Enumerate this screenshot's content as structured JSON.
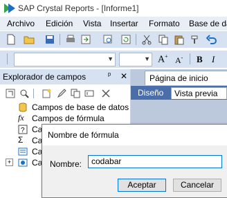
{
  "window": {
    "title": "SAP Crystal Reports - [Informe1]"
  },
  "menubar": {
    "items": [
      "Archivo",
      "Edición",
      "Vista",
      "Insertar",
      "Formato",
      "Base de da"
    ]
  },
  "explorer": {
    "title": "Explorador de campos",
    "pin": "ᵖ",
    "close": "✕",
    "tree": [
      {
        "label": "Campos de base de datos",
        "icon": "database-icon"
      },
      {
        "label": "Campos de fórmula",
        "icon": "formula-icon"
      },
      {
        "label": "Ca",
        "icon": "parameter-icon"
      },
      {
        "label": "Ca",
        "icon": "running-total-icon"
      },
      {
        "label": "Ca",
        "icon": "sql-icon"
      },
      {
        "label": "Ca",
        "icon": "special-fields-icon"
      }
    ]
  },
  "tabs": {
    "start_page": "Página de inicio",
    "design": "Diseño",
    "preview": "Vista previa"
  },
  "dialog": {
    "title": "Nombre de fórmula",
    "name_label": "Nombre:",
    "name_value": "codabar",
    "ok": "Aceptar",
    "cancel": "Cancelar"
  }
}
